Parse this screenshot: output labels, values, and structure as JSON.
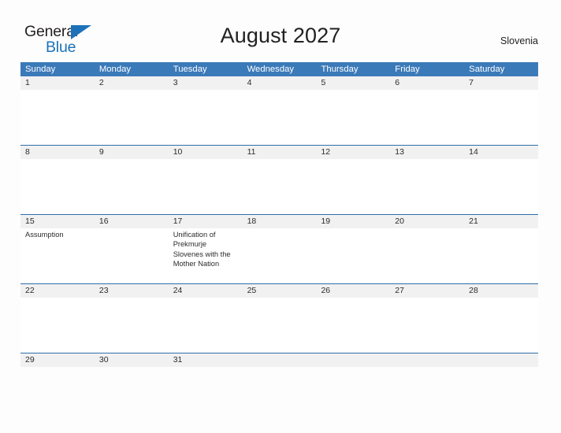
{
  "brand": {
    "name_part1": "General",
    "name_part2": "Blue",
    "triangle_icon": "triangle-icon",
    "color_dark": "#231f20",
    "color_blue": "#1c72b8"
  },
  "header": {
    "title": "August 2027",
    "region": "Slovenia"
  },
  "theme": {
    "header_blue": "#3b7ab9",
    "row_divider_blue": "#2f6da8",
    "date_band_gray": "#f1f1f1",
    "page_background": "#fdfdfd",
    "text": "#2b2b2b"
  },
  "calendar": {
    "weekdays": [
      "Sunday",
      "Monday",
      "Tuesday",
      "Wednesday",
      "Thursday",
      "Friday",
      "Saturday"
    ],
    "weeks": [
      {
        "dates": [
          "1",
          "2",
          "3",
          "4",
          "5",
          "6",
          "7"
        ],
        "events": [
          "",
          "",
          "",
          "",
          "",
          "",
          ""
        ]
      },
      {
        "dates": [
          "8",
          "9",
          "10",
          "11",
          "12",
          "13",
          "14"
        ],
        "events": [
          "",
          "",
          "",
          "",
          "",
          "",
          ""
        ]
      },
      {
        "dates": [
          "15",
          "16",
          "17",
          "18",
          "19",
          "20",
          "21"
        ],
        "events": [
          "Assumption",
          "",
          "Unification of Prekmurje Slovenes with the Mother Nation",
          "",
          "",
          "",
          ""
        ]
      },
      {
        "dates": [
          "22",
          "23",
          "24",
          "25",
          "26",
          "27",
          "28"
        ],
        "events": [
          "",
          "",
          "",
          "",
          "",
          "",
          ""
        ]
      },
      {
        "dates": [
          "29",
          "30",
          "31",
          "",
          "",
          "",
          ""
        ],
        "events": [
          "",
          "",
          "",
          "",
          "",
          "",
          ""
        ]
      }
    ]
  }
}
